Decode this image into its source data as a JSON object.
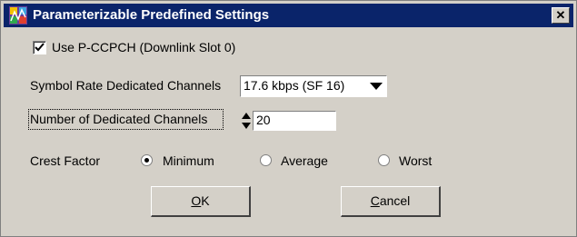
{
  "dialog": {
    "title": "Parameterizable Predefined Settings",
    "close_glyph": "✕"
  },
  "pccpch": {
    "label": "Use P-CCPCH (Downlink Slot 0)",
    "checked": true
  },
  "symbol_rate": {
    "label": "Symbol Rate Dedicated Channels",
    "value": "17.6 kbps (SF 16)"
  },
  "dedicated_channels": {
    "label": "Number of Dedicated Channels",
    "value": "20"
  },
  "crest_factor": {
    "label": "Crest Factor",
    "options": [
      {
        "label": "Minimum",
        "selected": true
      },
      {
        "label": "Average",
        "selected": false
      },
      {
        "label": "Worst",
        "selected": false
      }
    ]
  },
  "buttons": {
    "ok_mnemonic": "O",
    "ok_rest": "K",
    "cancel_mnemonic": "C",
    "cancel_rest": "ancel"
  }
}
